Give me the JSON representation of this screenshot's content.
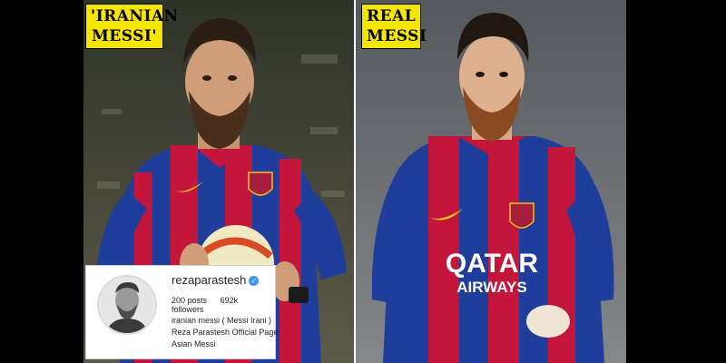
{
  "captions": {
    "left": [
      "'IRANIAN",
      "MESSI'"
    ],
    "right": [
      "REAL",
      "MESSI"
    ]
  },
  "jersey": {
    "sponsor_line1": "QATAR",
    "sponsor_line2": "AIRWAYS"
  },
  "instagram": {
    "username": "rezaparastesh",
    "verified_icon": "verified-check-icon",
    "posts": "200",
    "posts_label": "posts",
    "followers": "692k",
    "followers_label": "followers",
    "name": "iranian messi ( Messi Irani )",
    "bio_line1": "Reza Parastesh Official Page",
    "bio_line2": "Asian Messi"
  },
  "colors": {
    "caption_bg": "#f5e600",
    "jersey_red": "#c4163a",
    "jersey_blue": "#1f3e9c",
    "verified_blue": "#3897f0"
  }
}
